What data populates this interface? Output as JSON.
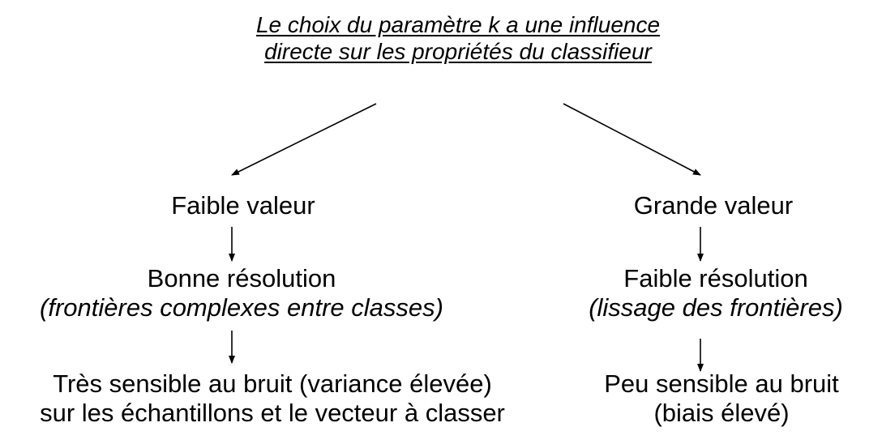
{
  "title": {
    "line1": "Le choix du paramètre k a une influence",
    "line2": "directe sur les propriétés du classifieur"
  },
  "left": {
    "value": "Faible valeur",
    "effect": "Bonne résolution",
    "effect_detail": "(frontières complexes entre classes)",
    "consequence_line1": "Très sensible au bruit (variance élevée)",
    "consequence_line2": "sur les échantillons et le vecteur à classer"
  },
  "right": {
    "value": "Grande valeur",
    "effect": "Faible résolution",
    "effect_detail": "(lissage des frontières)",
    "consequence_line1": "Peu sensible au bruit",
    "consequence_line2": "(biais élevé)"
  },
  "colors": {
    "text": "#000000",
    "arrows": "#000000",
    "background": "#ffffff"
  }
}
